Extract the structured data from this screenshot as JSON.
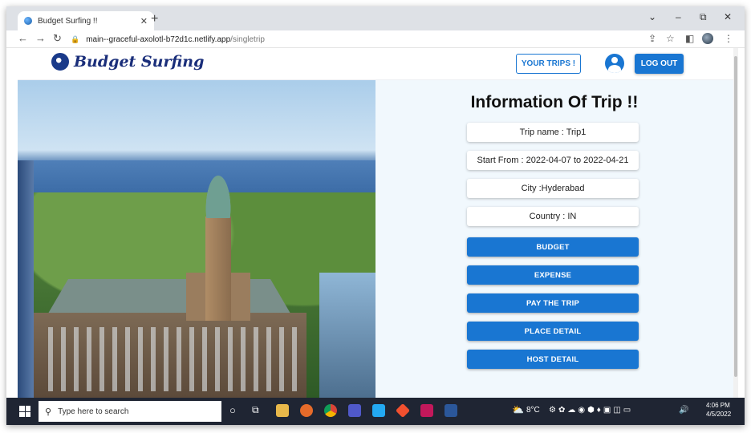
{
  "browser": {
    "tab_title": "Budget Surfing !!",
    "tab_close": "✕",
    "new_tab": "+",
    "url_host": "main--graceful-axolotl-b72d1c.netlify.app",
    "url_path": "/singletrip",
    "win_min": "–",
    "win_max": "⧉",
    "win_close": "✕"
  },
  "navbar": {
    "brand": "Budget Surfing",
    "your_trips": "YOUR TRIPS !",
    "logout": "LOG OUT"
  },
  "info": {
    "title": "Information Of Trip !!",
    "trip_name": "Trip name : Trip1",
    "start_from": "Start From : 2022-04-07 to 2022-04-21",
    "city": "City :Hyderabad",
    "country": "Country : IN"
  },
  "actions": {
    "budget": "BUDGET",
    "expense": "EXPENSE",
    "pay": "PAY THE TRIP",
    "place": "PLACE DETAIL",
    "host": "HOST DETAIL"
  },
  "taskbar": {
    "search_placeholder": "Type here to search",
    "temperature": "8°C",
    "time": "4:06 PM",
    "date": "4/5/2022"
  },
  "colors": {
    "primary": "#1976d2",
    "info_bg": "#f1f8fd",
    "taskbar": "#1f2533"
  }
}
